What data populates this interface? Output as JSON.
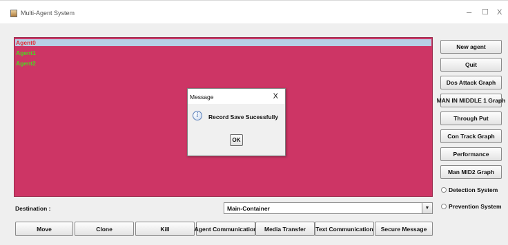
{
  "window": {
    "title": "Multi-Agent System",
    "minimize": "–",
    "maximize": "☐",
    "close": "X"
  },
  "agents": [
    {
      "name": "Agent0",
      "selected": true,
      "color": "#e0303a"
    },
    {
      "name": "Agent1",
      "selected": false,
      "color": "#4fd624"
    },
    {
      "name": "Agent2",
      "selected": false,
      "color": "#4fd624"
    }
  ],
  "panel_color": "#cd3565",
  "side_buttons": [
    "New agent",
    "Quit",
    "Dos Attack Graph",
    "MAN IN MIDDLE 1 Graph",
    "Through Put",
    "Con Track Graph",
    "Performance",
    "Man MID2 Graph"
  ],
  "radios": [
    {
      "label": "Detection System",
      "checked": false
    },
    {
      "label": "Prevention System",
      "checked": false
    }
  ],
  "destination": {
    "label": "Destination :",
    "selected": "Main-Container",
    "arrow": "▼"
  },
  "bottom_buttons": [
    "Move",
    "Clone",
    "Kill",
    "Agent Communication",
    "Media Transfer",
    "Text Communication",
    "Secure Message"
  ],
  "dialog": {
    "title": "Message",
    "close": "X",
    "icon": "i",
    "message": "Record Save Sucessfully",
    "ok_label": "OK"
  }
}
